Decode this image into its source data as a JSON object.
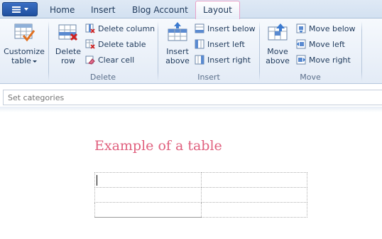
{
  "tabs": {
    "home": "Home",
    "insert": "Insert",
    "blog_account": "Blog Account",
    "layout": "Layout"
  },
  "ribbon": {
    "customize_table": [
      "Customize",
      "table"
    ],
    "delete_group": {
      "label": "Delete",
      "delete_row": [
        "Delete",
        "row"
      ],
      "delete_column": "Delete column",
      "delete_table": "Delete table",
      "clear_cell": "Clear cell"
    },
    "insert_group": {
      "label": "Insert",
      "insert_above": [
        "Insert",
        "above"
      ],
      "insert_below": "Insert below",
      "insert_left": "Insert left",
      "insert_right": "Insert right"
    },
    "move_group": {
      "label": "Move",
      "move_above": [
        "Move",
        "above"
      ],
      "move_below": "Move below",
      "move_left": "Move left",
      "move_right": "Move right"
    }
  },
  "category_bar": {
    "placeholder": "Set categories"
  },
  "document": {
    "title": "Example of a table",
    "table": {
      "rows": 3,
      "columns": 2
    }
  },
  "colors": {
    "title_accent": "#e0607e",
    "active_tab_border": "#e8a0c8",
    "app_button": "#2a5cb0"
  }
}
